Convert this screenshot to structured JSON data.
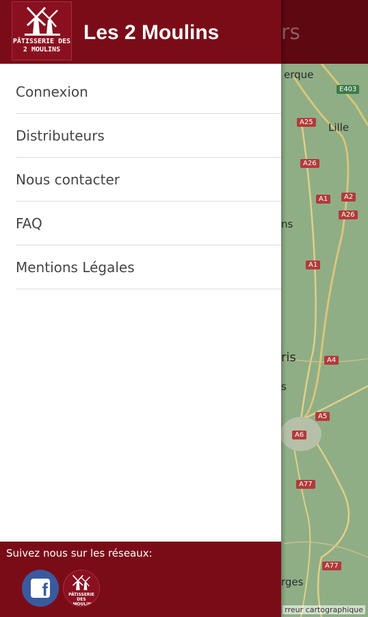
{
  "app": {
    "header_title_partial": "urs"
  },
  "map": {
    "labels": {
      "dunkerque": "erque",
      "lille": "Lille",
      "amiens": "ns",
      "paris": "ris",
      "paris2": "s",
      "bourges": "rges"
    },
    "roads": [
      "E403",
      "A25",
      "A26",
      "A1",
      "A2",
      "A26",
      "A1",
      "A4",
      "A5",
      "A6",
      "A77",
      "A77"
    ],
    "attribution": "rreur cartographique"
  },
  "drawer": {
    "brand_title": "Les 2 Moulins",
    "logo_text_line1": "PÂTISSERIE DES",
    "logo_text_line2": "2 MOULINS",
    "menu": [
      {
        "label": "Connexion"
      },
      {
        "label": "Distributeurs"
      },
      {
        "label": "Nous contacter"
      },
      {
        "label": "FAQ"
      },
      {
        "label": "Mentions Légales"
      }
    ],
    "footer": {
      "follow_text": "Suivez nous sur les réseaux:",
      "facebook_glyph": "f",
      "site_logo_line1": "PÂTISSERIE DES",
      "site_logo_line2": "2 MOULINS"
    }
  },
  "colors": {
    "brand": "#7a0c18",
    "header_dark": "#5e0812",
    "facebook": "#3a5a9e"
  }
}
